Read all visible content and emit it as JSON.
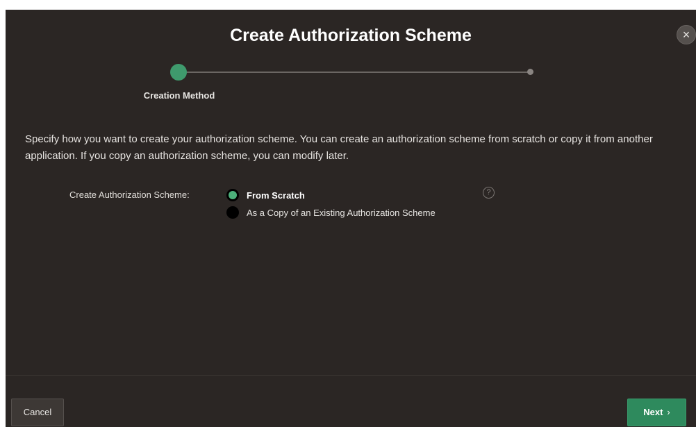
{
  "dialog": {
    "title": "Create Authorization Scheme",
    "close_icon": "×"
  },
  "wizard": {
    "steps": [
      {
        "label": "Creation Method",
        "state": "active"
      },
      {
        "label": "",
        "state": "upcoming"
      }
    ]
  },
  "description": "Specify how you want to create your authorization scheme. You can create an authorization scheme from scratch or copy it from another application. If you copy an authorization scheme, you can modify later.",
  "form": {
    "field_label": "Create Authorization Scheme:",
    "options": [
      {
        "label": "From Scratch",
        "checked": true
      },
      {
        "label": "As a Copy of an Existing Authorization Scheme",
        "checked": false
      }
    ],
    "help_icon": "?"
  },
  "footer": {
    "cancel_label": "Cancel",
    "next_label": "Next",
    "next_chevron": "›"
  },
  "colors": {
    "background": "#2b2624",
    "accent": "#3f9a6d",
    "button_primary": "#2e8a5d"
  }
}
